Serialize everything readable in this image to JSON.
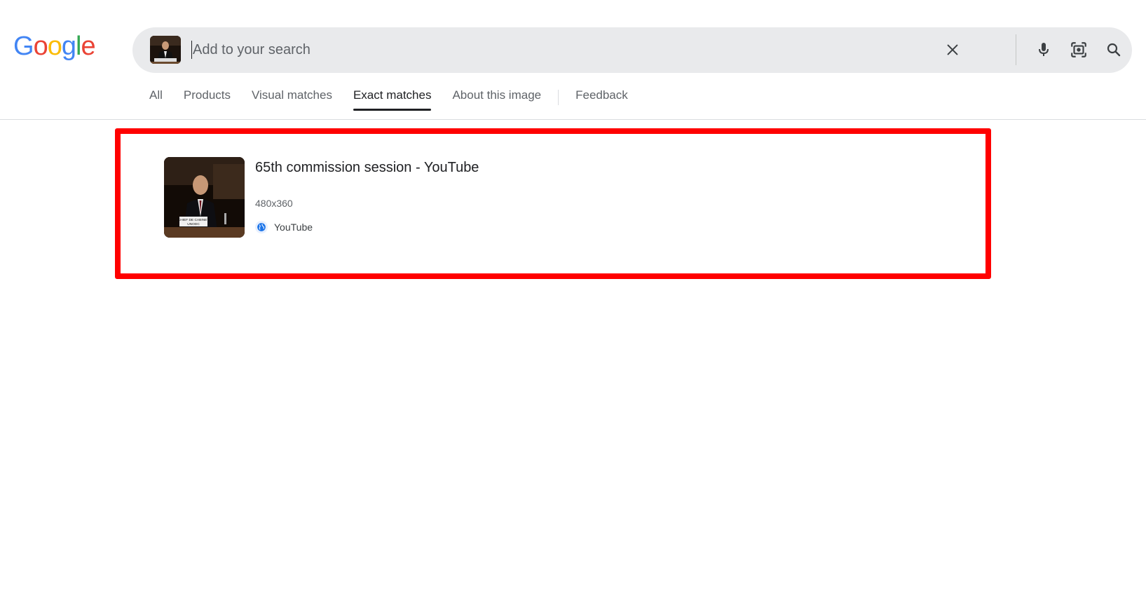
{
  "brand": {
    "logo_letters": [
      "G",
      "o",
      "o",
      "g",
      "l",
      "e"
    ],
    "logo_colors": [
      "#4285F4",
      "#EA4335",
      "#FBBC05",
      "#4285F4",
      "#34A853",
      "#EA4335"
    ]
  },
  "search": {
    "placeholder": "Add to your search",
    "value": "",
    "query_image_icon": "image-thumbnail",
    "clear_icon": "close-icon",
    "voice_icon": "microphone-icon",
    "lens_icon": "camera-lens-icon",
    "search_icon": "search-icon"
  },
  "tabs": [
    {
      "label": "All",
      "active": false
    },
    {
      "label": "Products",
      "active": false
    },
    {
      "label": "Visual matches",
      "active": false
    },
    {
      "label": "Exact matches",
      "active": true
    },
    {
      "label": "About this image",
      "active": false
    }
  ],
  "feedback_label": "Feedback",
  "results": [
    {
      "title": "65th commission session - YouTube",
      "dimensions": "480x360",
      "source": "YouTube",
      "favicon": "globe-icon",
      "thumbnail_caption": "CHIEF DE CABINET UNODC"
    }
  ],
  "colors": {
    "highlight": "#ff0000",
    "searchbar_bg": "#e9eaec",
    "text_primary": "#202124",
    "text_secondary": "#5f6368"
  }
}
